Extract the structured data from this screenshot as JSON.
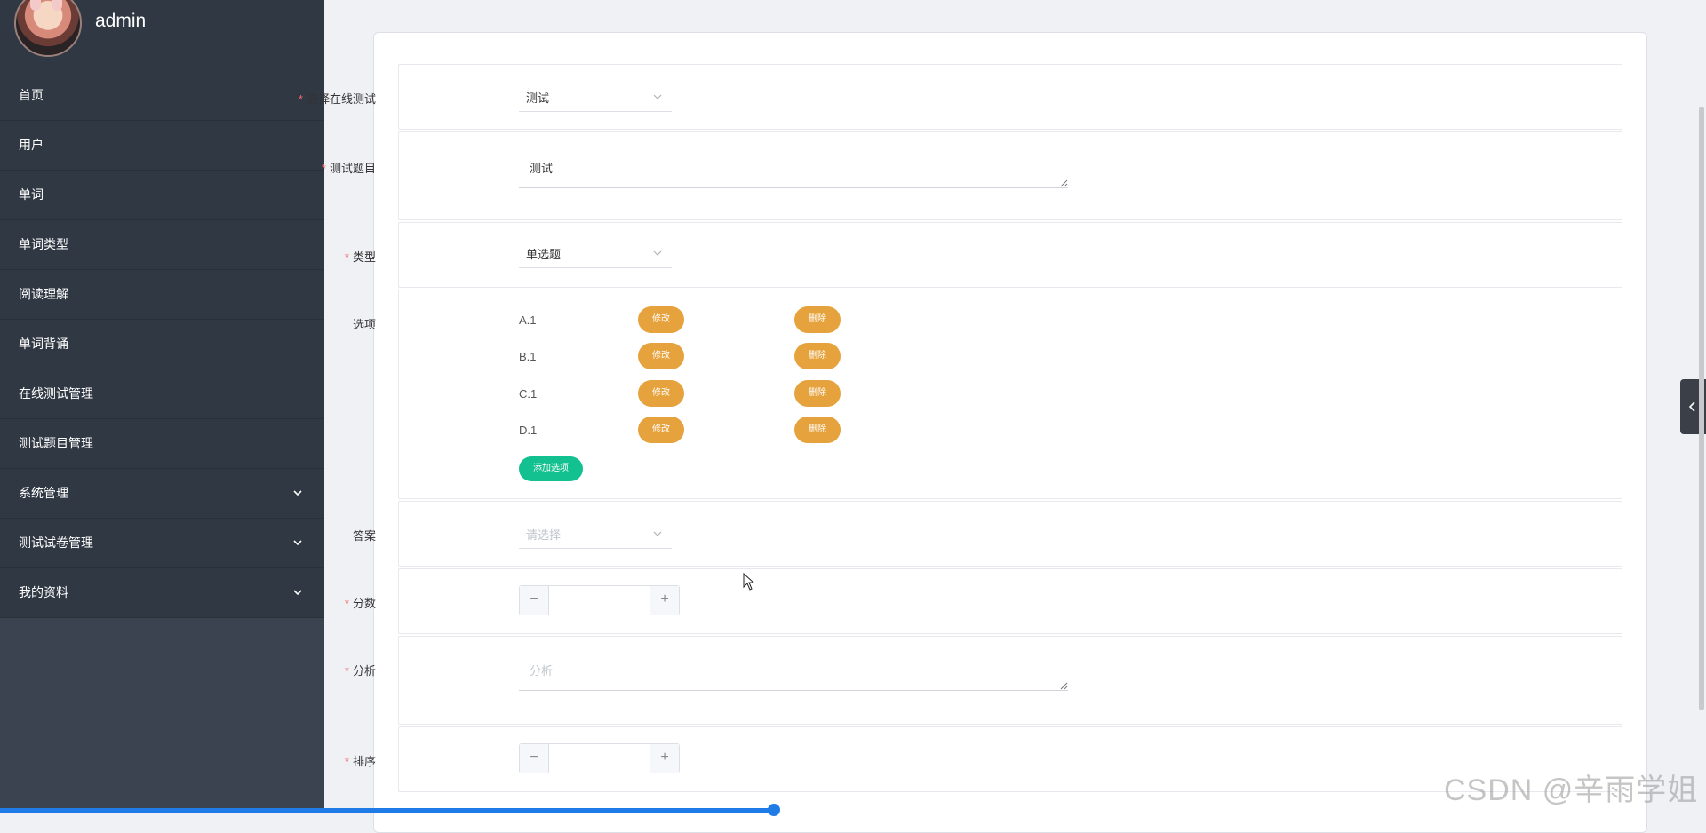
{
  "user": {
    "name": "admin"
  },
  "sidebar": {
    "items": [
      {
        "label": "首页",
        "expandable": false
      },
      {
        "label": "用户",
        "expandable": false
      },
      {
        "label": "单词",
        "expandable": false
      },
      {
        "label": "单词类型",
        "expandable": false
      },
      {
        "label": "阅读理解",
        "expandable": false
      },
      {
        "label": "单词背诵",
        "expandable": false
      },
      {
        "label": "在线测试管理",
        "expandable": false
      },
      {
        "label": "测试题目管理",
        "expandable": false
      },
      {
        "label": "系统管理",
        "expandable": true
      },
      {
        "label": "测试试卷管理",
        "expandable": true
      },
      {
        "label": "我的资料",
        "expandable": true
      }
    ]
  },
  "form": {
    "online_test": {
      "label": "选择在线测试",
      "value": "测试"
    },
    "question": {
      "label": "测试题目",
      "value": "测试"
    },
    "type": {
      "label": "类型",
      "value": "单选题"
    },
    "options": {
      "label": "选项",
      "items": [
        "A.1",
        "B.1",
        "C.1",
        "D.1"
      ],
      "edit_label": "修改",
      "delete_label": "删除",
      "add_label": "添加选项"
    },
    "answer": {
      "label": "答案",
      "placeholder": "请选择"
    },
    "score": {
      "label": "分数",
      "value": ""
    },
    "analysis": {
      "label": "分析",
      "placeholder": "分析"
    },
    "sort": {
      "label": "排序",
      "value": ""
    }
  },
  "watermark": "CSDN @辛雨学姐",
  "colors": {
    "sidebar_bg": "#303843",
    "warning": "#e6a23c",
    "success": "#13c08f",
    "required": "#f56c6c",
    "accent": "#1f7ce6"
  }
}
